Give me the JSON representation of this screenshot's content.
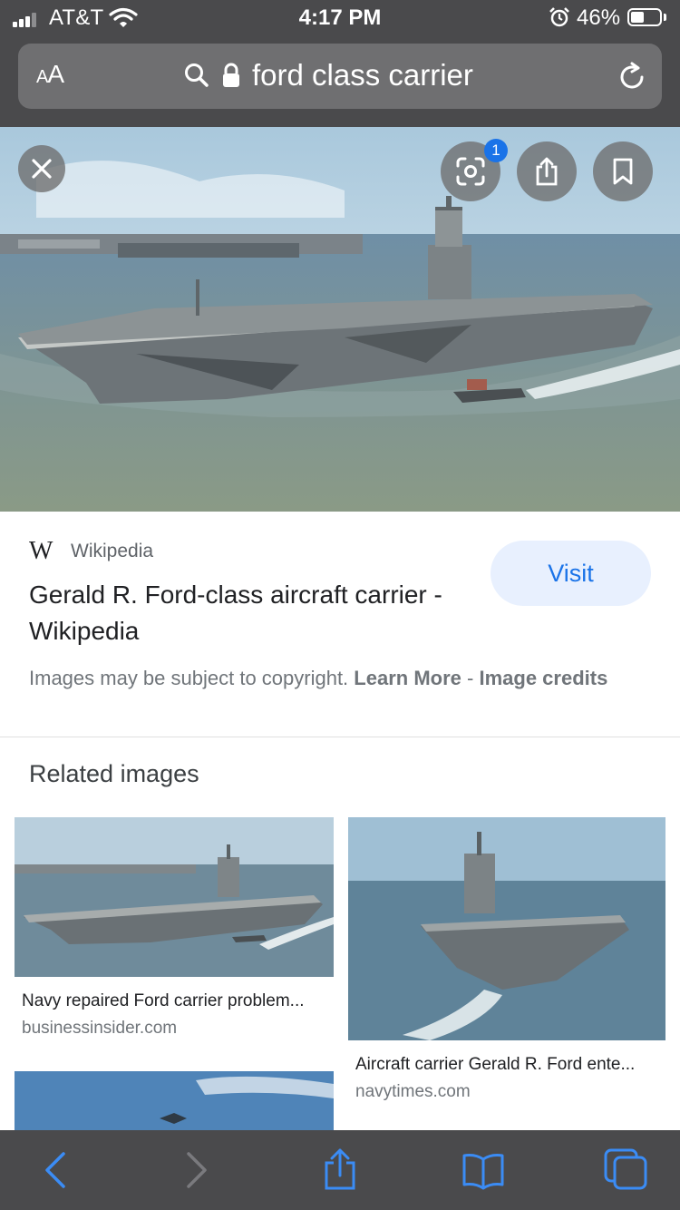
{
  "status_bar": {
    "carrier": "AT&T",
    "time": "4:17 PM",
    "battery_percent": "46%",
    "battery_level": 0.46,
    "icons": [
      "signal-icon",
      "wifi-icon",
      "alarm-icon",
      "battery-icon"
    ]
  },
  "url_bar": {
    "text_size_label": "AA",
    "url_text": "ford class carrier",
    "icons": [
      "search-icon",
      "lock-icon",
      "reload-icon"
    ]
  },
  "hero": {
    "badge_count": "1",
    "icons": [
      "close-icon",
      "lens-icon",
      "share-icon",
      "bookmark-icon"
    ]
  },
  "result": {
    "source_logo": "W",
    "source_name": "Wikipedia",
    "title": "Gerald R. Ford-class aircraft carrier - Wikipedia",
    "visit_label": "Visit",
    "copyright_text": "Images may be subject to copyright.",
    "learn_more": "Learn More",
    "separator": "-",
    "image_credits": "Image credits"
  },
  "related": {
    "heading": "Related images",
    "items": [
      {
        "title": "Navy repaired Ford carrier problem...",
        "source": "businessinsider.com"
      },
      {
        "title": "Aircraft carrier Gerald R. Ford ente...",
        "source": "navytimes.com"
      }
    ]
  },
  "toolbar": {
    "icons": [
      "back-icon",
      "forward-icon",
      "share-icon",
      "bookmarks-icon",
      "tabs-icon"
    ]
  },
  "colors": {
    "chrome": "#4a4a4c",
    "url_field": "#6f6f71",
    "accent": "#1a73e8",
    "visit_bg": "#e8f0fe",
    "secondary_text": "#70757a"
  }
}
